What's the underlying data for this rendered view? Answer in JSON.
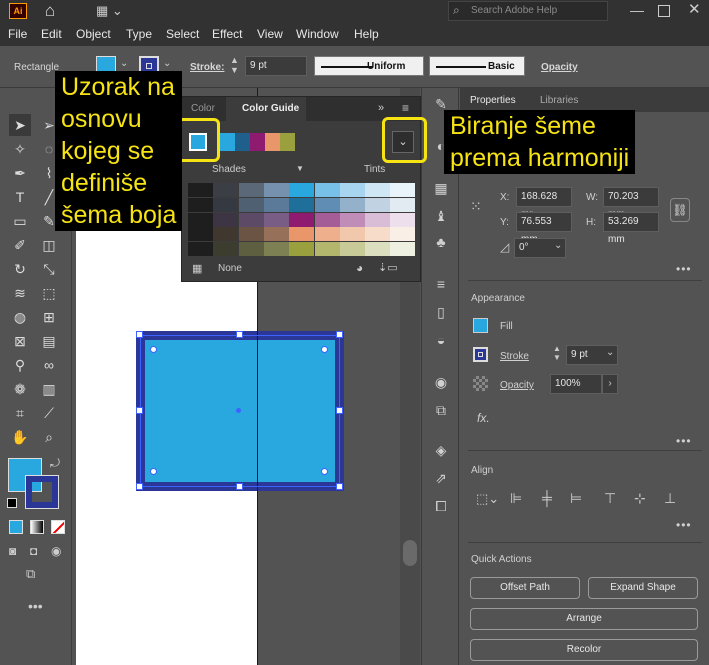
{
  "app": {
    "logo": "Ai"
  },
  "titlebar": {
    "search_placeholder": "Search Adobe Help"
  },
  "menu": [
    "File",
    "Edit",
    "Object",
    "Type",
    "Select",
    "Effect",
    "View",
    "Window",
    "Help"
  ],
  "controlbar": {
    "object_type": "Rectangle",
    "stroke_label": "Stroke:",
    "stroke_weight": "9 pt",
    "profile": "Uniform",
    "brush": "Basic",
    "opacity_label": "Opacity"
  },
  "color_guide": {
    "tab_color": "Color",
    "tab_guide": "Color Guide",
    "base_color": "#29a8e0",
    "harmony_swatches": [
      "#29a8e0",
      "#1f5f8b",
      "#8e1b6f",
      "#e8966a",
      "#9aa03e"
    ],
    "shades_label": "Shades",
    "tints_label": "Tints",
    "none_label": "None",
    "grid_colors": [
      [
        "#1e1e1e",
        "#3b3f45",
        "#5a6878",
        "#7591ad",
        "#29a8e0",
        "#77c0e8",
        "#a7d4ee",
        "#cfe6f5",
        "#e8f3fa"
      ],
      [
        "#1e1e1e",
        "#353a42",
        "#4f6072",
        "#5b7a99",
        "#1f6f9b",
        "#5f8db3",
        "#94b1cc",
        "#c1d2e3",
        "#e2eaf2"
      ],
      [
        "#1e1e1e",
        "#3d3444",
        "#5d4a66",
        "#7a5d85",
        "#8e1b6f",
        "#a55d98",
        "#c08db9",
        "#d9bdd6",
        "#ede0ec"
      ],
      [
        "#1e1e1e",
        "#40382f",
        "#6b5443",
        "#97705a",
        "#e8966a",
        "#eeb08c",
        "#f2c8ac",
        "#f6dcc9",
        "#faefe6"
      ],
      [
        "#1e1e1e",
        "#3c3d2f",
        "#5d5f40",
        "#7d8052",
        "#9aa03e",
        "#b3b76e",
        "#c8cb98",
        "#dcdec0",
        "#eef0e1"
      ]
    ]
  },
  "properties": {
    "tab_properties": "Properties",
    "tab_libraries": "Libraries",
    "x_label": "X:",
    "x_value": "168.628 mr",
    "y_label": "Y:",
    "y_value": "76.553 mm",
    "w_label": "W:",
    "w_value": "70.203 mm",
    "h_label": "H:",
    "h_value": "53.269 mm",
    "rotation": "0°",
    "appearance_title": "Appearance",
    "fill_label": "Fill",
    "stroke_label": "Stroke",
    "stroke_weight": "9 pt",
    "opacity_label": "Opacity",
    "opacity_value": "100%",
    "fx_label": "fx.",
    "align_title": "Align",
    "quick_actions_title": "Quick Actions",
    "offset_path": "Offset Path",
    "expand_shape": "Expand Shape",
    "arrange": "Arrange",
    "recolor": "Recolor"
  },
  "canvas": {
    "fill_color": "#29a8e0",
    "stroke_color": "#2b3796"
  },
  "callouts": {
    "left": "Uzorak na\nosnovu\nkojeg se\ndefiniše\nšema boja",
    "right": "Biranje šeme\nprema harmoniji"
  }
}
